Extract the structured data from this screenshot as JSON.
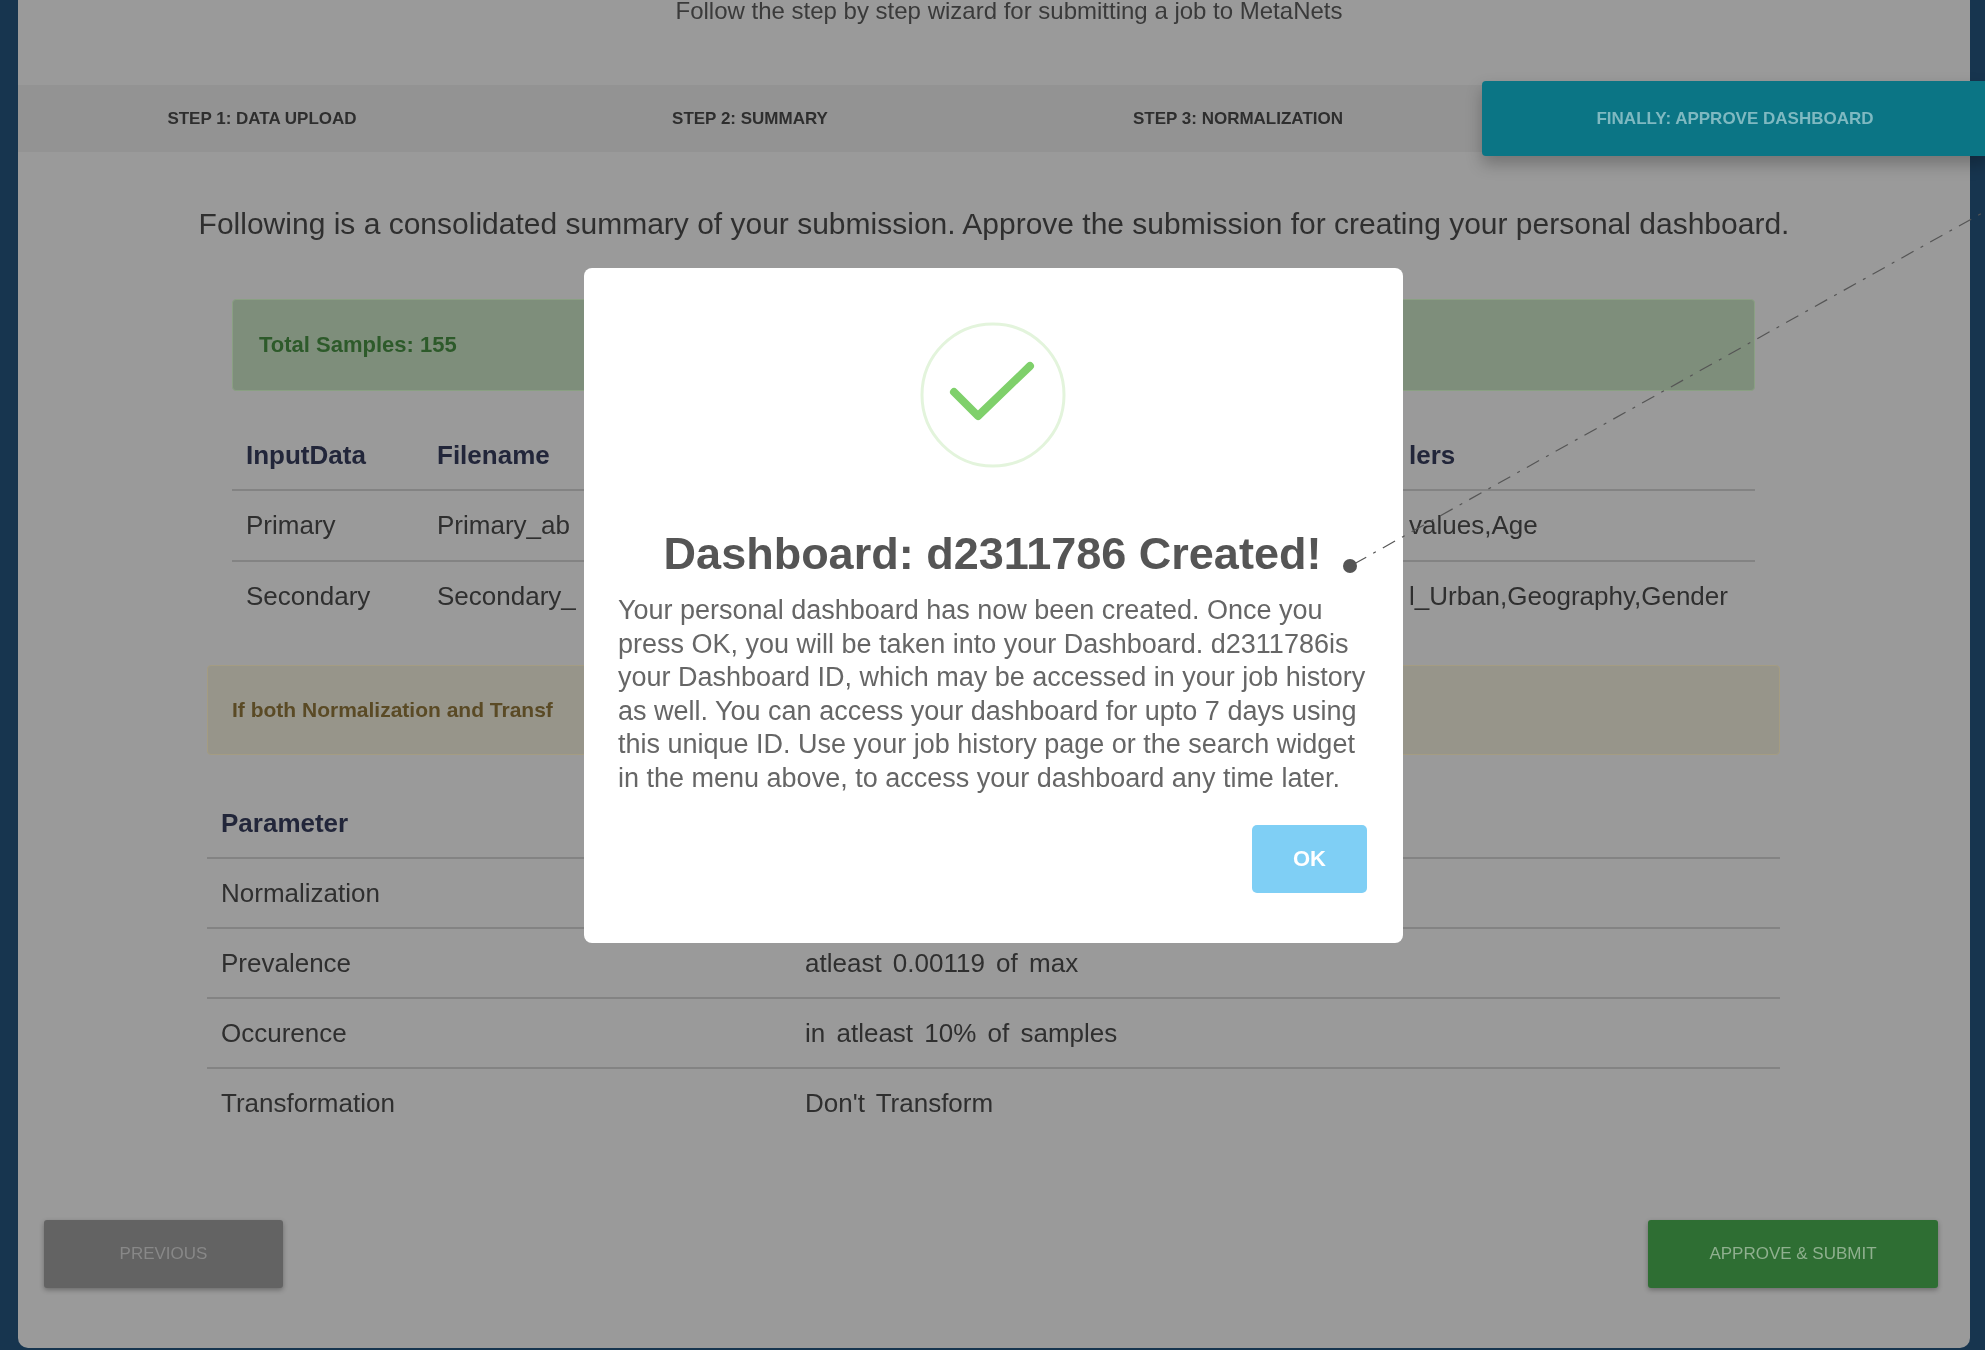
{
  "header": {
    "subtitle": "Follow the step by step wizard for submitting a job to MetaNets"
  },
  "steps": [
    {
      "label": "STEP 1: DATA UPLOAD",
      "selected": false
    },
    {
      "label": "STEP 2: SUMMARY",
      "selected": false
    },
    {
      "label": "STEP 3: NORMALIZATION",
      "selected": false
    },
    {
      "label": "FINALLY: APPROVE DASHBOARD",
      "selected": true
    }
  ],
  "intro": "Following is a consolidated summary of your submission. Approve the submission for creating your personal dashboard.",
  "samples_alert": "Total Samples: 155",
  "input_table": {
    "columns": [
      "InputData",
      "Filename",
      "lers"
    ],
    "rows": [
      [
        "Primary",
        "Primary_ab",
        "values,Age"
      ],
      [
        "Secondary",
        "Secondary_",
        "l_Urban,Geography,Gender"
      ]
    ]
  },
  "warning_alert": "If both Normalization and Transf",
  "parameter_table": {
    "columns": [
      "Parameter"
    ],
    "rows": [
      {
        "parameter": "Normalization"
      },
      {
        "parameter": "Prevalence",
        "value": "atleast 0.00119 of max"
      },
      {
        "parameter": "Occurence",
        "value": "in atleast 10% of samples"
      },
      {
        "parameter": "Transformation",
        "value": "Don't Transform"
      }
    ]
  },
  "buttons": {
    "previous": "PREVIOUS",
    "submit": "APPROVE & SUBMIT"
  },
  "dialog": {
    "title": "Dashboard: d2311786 Created!",
    "message": "Your personal dashboard has now been created. Once you press OK, you will be taken into your Dashboard. d2311786is your Dashboard ID, which may be accessed in your job history as well. You can access your dashboard for upto 7 days using this unique ID. Use your job history page or the search widget in the menu above, to access your dashboard any time later.",
    "button": "OK"
  }
}
